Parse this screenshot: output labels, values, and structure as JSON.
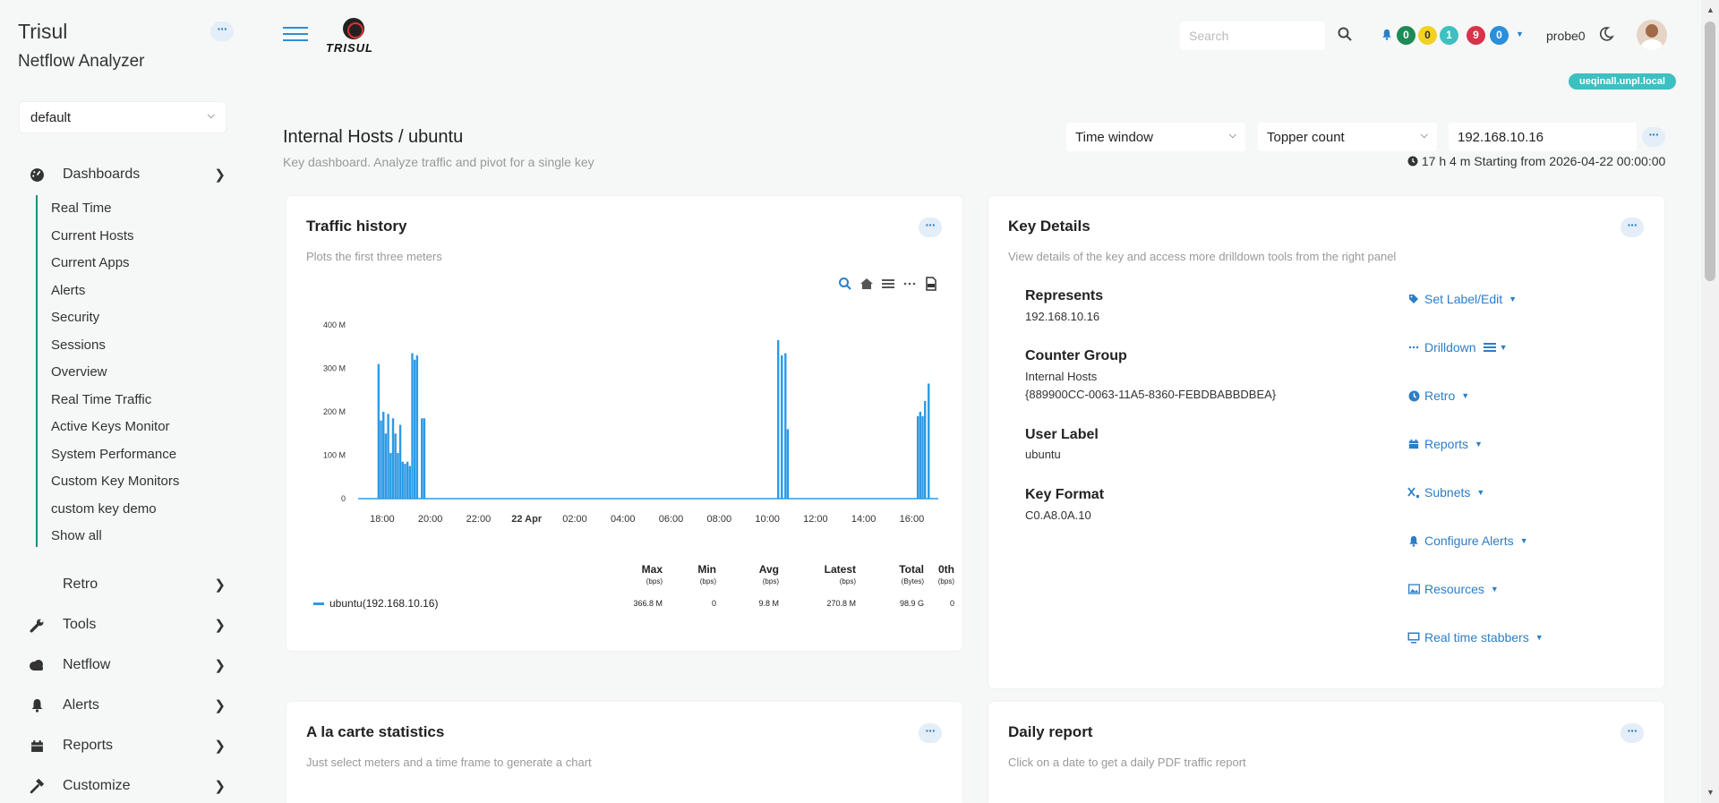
{
  "sidebar": {
    "title": "Trisul",
    "subtitle": "Netflow Analyzer",
    "context_select": "default",
    "menu": [
      {
        "label": "Dashboards",
        "icon": "dashboard-gauge-icon"
      },
      {
        "label": "Retro",
        "icon": ""
      },
      {
        "label": "Tools",
        "icon": "wrench-icon"
      },
      {
        "label": "Netflow",
        "icon": "cloud-icon"
      },
      {
        "label": "Alerts",
        "icon": "bell-icon"
      },
      {
        "label": "Reports",
        "icon": "calendar-icon"
      },
      {
        "label": "Customize",
        "icon": "hammer-icon"
      }
    ],
    "dashboards": [
      "Real Time",
      "Current Hosts",
      "Current Apps",
      "Alerts",
      "Security",
      "Sessions",
      "Overview",
      "Real Time Traffic",
      "Active Keys Monitor",
      "System Performance",
      "Custom Key Monitors",
      "custom key demo",
      "Show all"
    ]
  },
  "header": {
    "logo_text": "TRISUL",
    "search_placeholder": "Search",
    "badges": [
      {
        "value": "0",
        "color": "#1e8a56"
      },
      {
        "value": "0",
        "color": "#f2d21f"
      },
      {
        "value": "1",
        "color": "#3cc0c2"
      },
      {
        "value": "9",
        "color": "#d8334a"
      },
      {
        "value": "0",
        "color": "#2b8fd9"
      }
    ],
    "probe": "probe0",
    "host_badge": "ueqinall.unpl.local"
  },
  "page": {
    "title": "Internal Hosts / ubuntu",
    "subtitle": "Key dashboard. Analyze traffic and pivot for a single key",
    "time_window": "Time window",
    "topper_count": "Topper count",
    "key_value": "192.168.10.16",
    "window_info": "17 h 4 m Starting from 2026-04-22 00:00:00"
  },
  "traffic_history": {
    "title": "Traffic history",
    "subtitle": "Plots the first three meters",
    "legend": {
      "headers": [
        {
          "label": "Max",
          "unit": "(bps)"
        },
        {
          "label": "Min",
          "unit": "(bps)"
        },
        {
          "label": "Avg",
          "unit": "(bps)"
        },
        {
          "label": "Latest",
          "unit": "(bps)"
        },
        {
          "label": "Total",
          "unit": "(Bytes)"
        },
        {
          "label": "0th",
          "unit": "(bps)"
        }
      ],
      "series_name": "ubuntu(192.168.10.16)",
      "values": [
        "366.8 M",
        "0",
        "9.8 M",
        "270.8 M",
        "98.9 G",
        "0"
      ]
    }
  },
  "chart_data": {
    "type": "bar",
    "title": "",
    "xlabel": "",
    "ylabel": "",
    "ylim": [
      0,
      400
    ],
    "y_ticks": [
      "400 M",
      "300 M",
      "200 M",
      "100 M",
      "0"
    ],
    "x_ticks": [
      "18:00",
      "20:00",
      "22:00",
      "22 Apr",
      "02:00",
      "04:00",
      "06:00",
      "08:00",
      "10:00",
      "12:00",
      "14:00",
      "16:00"
    ],
    "x_range_hours": [
      -7,
      17.1
    ],
    "color": "#2b9be8",
    "series": [
      {
        "name": "ubuntu(192.168.10.16)",
        "points": [
          [
            -6.15,
            310
          ],
          [
            -6.05,
            180
          ],
          [
            -5.95,
            200
          ],
          [
            -5.85,
            150
          ],
          [
            -5.75,
            195
          ],
          [
            -5.65,
            105
          ],
          [
            -5.55,
            185
          ],
          [
            -5.45,
            150
          ],
          [
            -5.35,
            105
          ],
          [
            -5.25,
            170
          ],
          [
            -5.15,
            85
          ],
          [
            -5.05,
            80
          ],
          [
            -4.95,
            85
          ],
          [
            -4.85,
            75
          ],
          [
            -4.75,
            335
          ],
          [
            -4.65,
            320
          ],
          [
            -4.55,
            330
          ],
          [
            -4.35,
            185
          ],
          [
            -4.25,
            185
          ],
          [
            10.45,
            365
          ],
          [
            10.6,
            330
          ],
          [
            10.75,
            335
          ],
          [
            10.85,
            160
          ],
          [
            16.25,
            190
          ],
          [
            16.35,
            200
          ],
          [
            16.45,
            190
          ],
          [
            16.55,
            225
          ],
          [
            16.7,
            265
          ]
        ]
      }
    ]
  },
  "key_details": {
    "title": "Key Details",
    "subtitle": "View details of the key and access more drilldown tools from the right panel",
    "fields": [
      {
        "label": "Represents",
        "values": [
          "192.168.10.16"
        ]
      },
      {
        "label": "Counter Group",
        "values": [
          "Internal Hosts",
          "{889900CC-0063-11A5-8360-FEBDBABBDBEA}"
        ]
      },
      {
        "label": "User Label",
        "values": [
          "ubuntu"
        ]
      },
      {
        "label": "Key Format",
        "values": [
          "C0.A8.0A.10"
        ]
      }
    ],
    "tools": [
      {
        "label": "Set Label/Edit",
        "icon": "tag-icon"
      },
      {
        "label": "Drilldown",
        "icon": "ellipsis-icon"
      },
      {
        "label": "Retro",
        "icon": "clock-icon"
      },
      {
        "label": "Reports",
        "icon": "calendar-icon"
      },
      {
        "label": "Subnets",
        "icon": "subscript-icon"
      },
      {
        "label": "Configure Alerts",
        "icon": "bell-icon"
      },
      {
        "label": "Resources",
        "icon": "image-icon"
      },
      {
        "label": "Real time stabbers",
        "icon": "monitor-icon"
      }
    ]
  },
  "alacarte": {
    "title": "A la carte statistics",
    "subtitle": "Just select meters and a time frame to generate a chart"
  },
  "daily_report": {
    "title": "Daily report",
    "subtitle": "Click on a date to get a daily PDF traffic report"
  }
}
